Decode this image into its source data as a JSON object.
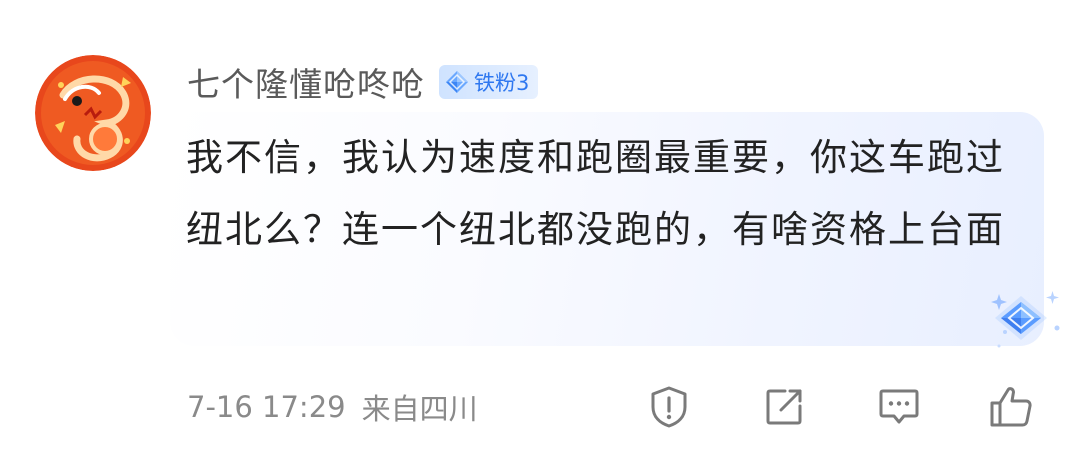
{
  "comment": {
    "username": "七个隆懂呛咚呛",
    "badge": {
      "label": "铁粉3",
      "icon": "diamond-icon",
      "text_color": "#2f78f0",
      "bg_color": "#d8e8ff"
    },
    "text": "我不信，我认为速度和跑圈最重要，你这车跑过纽北么？连一个纽北都没跑的，有啥资格上台面",
    "timestamp": "7-16 17:29",
    "location": "来自四川",
    "actions": [
      {
        "name": "report",
        "icon": "shield-exclamation-icon"
      },
      {
        "name": "share",
        "icon": "share-box-icon"
      },
      {
        "name": "reply",
        "icon": "comment-bubble-icon"
      },
      {
        "name": "like",
        "icon": "thumbs-up-icon"
      }
    ],
    "avatar": {
      "icon": "dragon-avatar",
      "bg_color": "#e8471c"
    },
    "bubble_decoration": "diamond-sparkle-icon"
  }
}
